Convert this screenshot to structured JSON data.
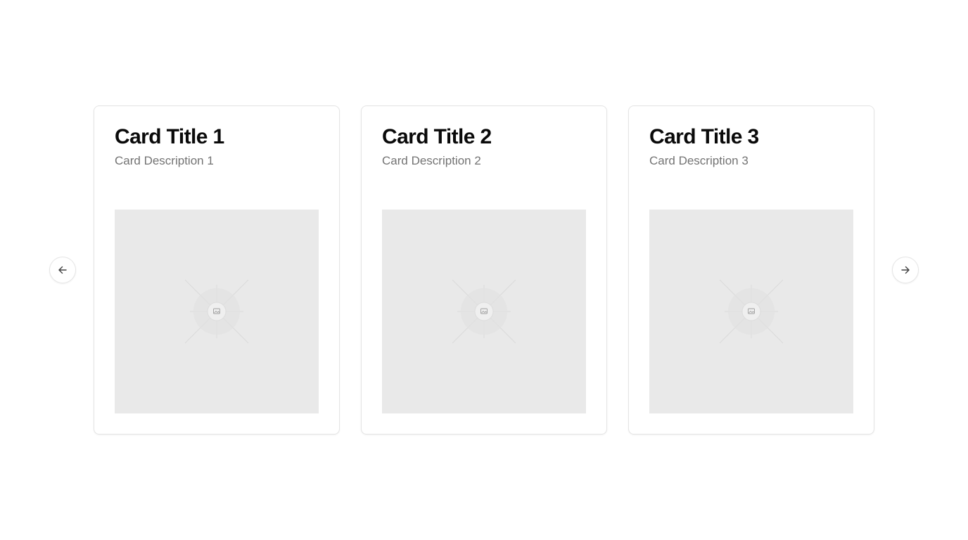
{
  "carousel": {
    "prev_icon": "arrow-left-icon",
    "next_icon": "arrow-right-icon",
    "cards": [
      {
        "title": "Card Title 1",
        "description": "Card Description 1",
        "image_icon": "image-placeholder-icon"
      },
      {
        "title": "Card Title 2",
        "description": "Card Description 2",
        "image_icon": "image-placeholder-icon"
      },
      {
        "title": "Card Title 3",
        "description": "Card Description 3",
        "image_icon": "image-placeholder-icon"
      }
    ]
  },
  "colors": {
    "title": "#0a0a0a",
    "description": "#737373",
    "placeholder_bg": "#e9e9e9",
    "border": "#e4e4e4"
  }
}
